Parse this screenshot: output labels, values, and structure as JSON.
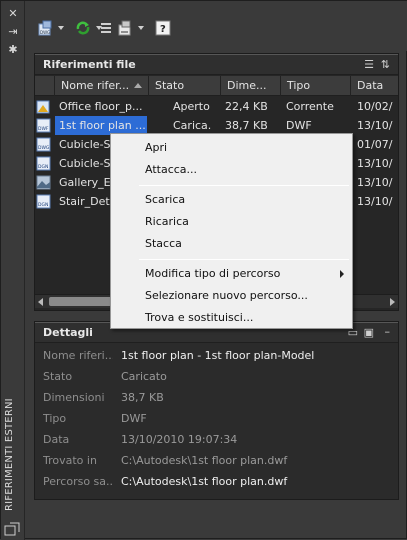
{
  "palette_title": "RIFERIMENTI ESTERNI",
  "refs_panel": {
    "title": "Riferimenti file",
    "columns": [
      "Nome rifer...",
      "Stato",
      "Dime...",
      "Tipo",
      "Data"
    ],
    "rows": [
      {
        "name": "Office floor_p...",
        "status": "Aperto",
        "size": "22,4 KB",
        "type": "Corrente",
        "date": "10/02/",
        "icon": "dwg-file-icon"
      },
      {
        "name": "1st floor plan ...",
        "status": "Carica...",
        "size": "38,7 KB",
        "type": "DWF",
        "date": "13/10/",
        "icon": "dwf-file-icon"
      },
      {
        "name": "Cubicle-S",
        "status": "",
        "size": "",
        "type": "",
        "date": "01/07/",
        "icon": "dwg-file-icon"
      },
      {
        "name": "Cubicle-S",
        "status": "",
        "size": "",
        "type": "",
        "date": "13/10/",
        "icon": "dgn-file-icon"
      },
      {
        "name": "Gallery_Ex",
        "status": "",
        "size": "",
        "type": "",
        "date": "13/10/",
        "icon": "image-file-icon"
      },
      {
        "name": "Stair_Deta",
        "status": "",
        "size": "",
        "type": "",
        "date": "13/10/",
        "icon": "dgn-file-icon"
      }
    ]
  },
  "context_menu": {
    "items": [
      "Apri",
      "Attacca...",
      "Scarica",
      "Ricarica",
      "Stacca",
      "Modifica tipo di percorso",
      "Selezionare nuovo percorso...",
      "Trova e sostituisci..."
    ]
  },
  "details": {
    "title": "Dettagli",
    "fields": [
      {
        "label": "Nome riferi...",
        "value": "1st floor plan - 1st floor plan-Model"
      },
      {
        "label": "Stato",
        "value": "Caricato"
      },
      {
        "label": "Dimensioni",
        "value": "38,7 KB"
      },
      {
        "label": "Tipo",
        "value": "DWF"
      },
      {
        "label": "Data",
        "value": "13/10/2010 19:07:34"
      },
      {
        "label": "Trovato in",
        "value": "C:\\Autodesk\\1st floor plan.dwf"
      },
      {
        "label": "Percorso sa...",
        "value": "C:\\Autodesk\\1st floor plan.dwf"
      }
    ]
  },
  "colors": {
    "selection": "#2d6cd6",
    "panel_bg": "#3a3a3a",
    "list_bg": "#262626",
    "menu_bg": "#f0f0f0"
  }
}
